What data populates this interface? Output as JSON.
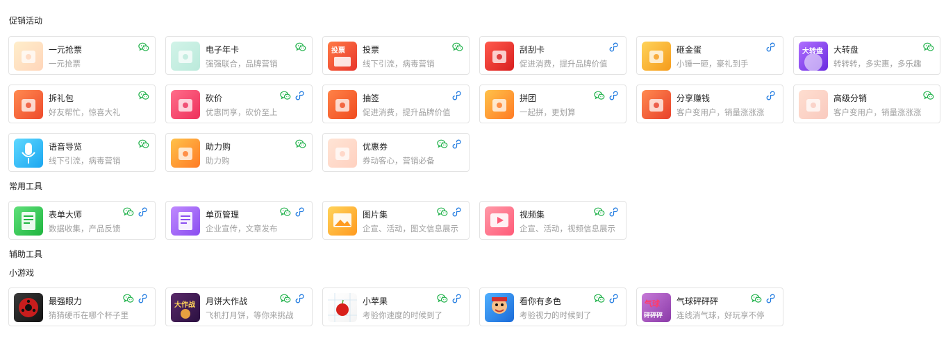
{
  "sections": {
    "promo": "促销活动",
    "tools": "常用工具",
    "aux": "辅助工具",
    "games": "小游戏"
  },
  "colors": {
    "wechat": "#22b24c",
    "miniprogram": "#1f7ae0"
  },
  "promo_items": [
    {
      "name": "一元抢票",
      "desc": "一元抢票",
      "icon": "ticket-icon",
      "wechat": true,
      "mini": false,
      "faded": true,
      "c1": "#ffcf6b",
      "c2": "#ff8a3d"
    },
    {
      "name": "电子年卡",
      "desc": "强强联合，品牌营销",
      "icon": "annual-card-icon",
      "wechat": true,
      "mini": false,
      "faded": true,
      "c1": "#7fe0c0",
      "c2": "#3fc39a"
    },
    {
      "name": "投票",
      "desc": "线下引流，病毒营销",
      "icon": "vote-icon",
      "wechat": true,
      "mini": false,
      "faded": false,
      "c1": "#ff7a45",
      "c2": "#e8362c"
    },
    {
      "name": "刮刮卡",
      "desc": "促进消费，提升品牌价值",
      "icon": "scratch-card-icon",
      "wechat": false,
      "mini": true,
      "faded": false,
      "c1": "#ff5a4d",
      "c2": "#d81e1e"
    },
    {
      "name": "砸金蛋",
      "desc": "小锤一砸，豪礼到手",
      "icon": "golden-egg-icon",
      "wechat": false,
      "mini": true,
      "faded": false,
      "c1": "#ffd35a",
      "c2": "#f59b1b"
    },
    {
      "name": "大转盘",
      "desc": "转转转，多实惠，多乐趣",
      "icon": "wheel-icon",
      "wechat": true,
      "mini": false,
      "faded": false,
      "c1": "#b070ff",
      "c2": "#6a2be0"
    },
    {
      "name": "拆礼包",
      "desc": "好友帮忙，惊喜大礼",
      "icon": "gift-icon",
      "wechat": true,
      "mini": false,
      "faded": false,
      "c1": "#ff8a50",
      "c2": "#ee4a2c"
    },
    {
      "name": "砍价",
      "desc": "优惠同享，砍价至上",
      "icon": "bargain-icon",
      "wechat": true,
      "mini": true,
      "faded": false,
      "c1": "#ff6d8a",
      "c2": "#ee2f5b"
    },
    {
      "name": "抽签",
      "desc": "促进消费，提升品牌价值",
      "icon": "lottery-icon",
      "wechat": false,
      "mini": true,
      "faded": false,
      "c1": "#ff8247",
      "c2": "#f04b1f"
    },
    {
      "name": "拼团",
      "desc": "一起拼，更划算",
      "icon": "group-buy-icon",
      "wechat": true,
      "mini": true,
      "faded": false,
      "c1": "#ffc24a",
      "c2": "#ff7b25"
    },
    {
      "name": "分享赚钱",
      "desc": "客户变用户，销量涨涨涨",
      "icon": "share-money-icon",
      "wechat": false,
      "mini": true,
      "faded": false,
      "c1": "#ff8a50",
      "c2": "#e8402a"
    },
    {
      "name": "高级分销",
      "desc": "客户变用户，销量涨涨涨",
      "icon": "distribution-icon",
      "wechat": true,
      "mini": false,
      "faded": true,
      "c1": "#ffa27a",
      "c2": "#f06a4a"
    },
    {
      "name": "语音导览",
      "desc": "线下引流，病毒营销",
      "icon": "voice-guide-icon",
      "wechat": true,
      "mini": false,
      "faded": false,
      "c1": "#5fd8ff",
      "c2": "#1aa6f0"
    },
    {
      "name": "助力购",
      "desc": "助力购",
      "icon": "assist-buy-icon",
      "wechat": true,
      "mini": false,
      "faded": false,
      "c1": "#ffc24a",
      "c2": "#ff7b25"
    },
    {
      "name": "优惠券",
      "desc": "券动客心，营销必备",
      "icon": "coupon-icon",
      "wechat": true,
      "mini": true,
      "faded": true,
      "c1": "#ffb48a",
      "c2": "#ff7d4d"
    }
  ],
  "tool_items": [
    {
      "name": "表单大师",
      "desc": "数据收集，产品反馈",
      "icon": "form-icon",
      "wechat": true,
      "mini": true,
      "faded": false,
      "c1": "#5fe07a",
      "c2": "#1fb53f"
    },
    {
      "name": "单页管理",
      "desc": "企业宣传，文章发布",
      "icon": "page-icon",
      "wechat": true,
      "mini": true,
      "faded": false,
      "c1": "#c08aff",
      "c2": "#8a4df0"
    },
    {
      "name": "图片集",
      "desc": "企宣、活动，图文信息展示",
      "icon": "gallery-icon",
      "wechat": true,
      "mini": true,
      "faded": false,
      "c1": "#ffd35a",
      "c2": "#ff9a1f"
    },
    {
      "name": "视频集",
      "desc": "企宣、活动，视频信息展示",
      "icon": "video-icon",
      "wechat": true,
      "mini": true,
      "faded": false,
      "c1": "#ff9aa8",
      "c2": "#ff5a78"
    }
  ],
  "game_items": [
    {
      "name": "最强眼力",
      "desc": "猜猜硬币在哪个杯子里",
      "icon": "eye-game-icon",
      "wechat": true,
      "mini": true,
      "faded": false,
      "c1": "#3a3a3a",
      "c2": "#111111"
    },
    {
      "name": "月饼大作战",
      "desc": "飞机打月饼，等你来挑战",
      "icon": "mooncake-game-icon",
      "wechat": true,
      "mini": true,
      "faded": false,
      "c1": "#5a2a6a",
      "c2": "#2a1040"
    },
    {
      "name": "小苹果",
      "desc": "考验你速度的时候到了",
      "icon": "apple-game-icon",
      "wechat": true,
      "mini": true,
      "faded": false,
      "c1": "#ffffff",
      "c2": "#f4f4f4"
    },
    {
      "name": "看你有多色",
      "desc": "考验视力的时候到了",
      "icon": "color-game-icon",
      "wechat": true,
      "mini": true,
      "faded": false,
      "c1": "#4fb0ff",
      "c2": "#1a6ad8"
    },
    {
      "name": "气球砰砰砰",
      "desc": "连线消气球，好玩享不停",
      "icon": "balloon-game-icon",
      "wechat": true,
      "mini": true,
      "faded": false,
      "c1": "#c77ad8",
      "c2": "#8a3aa8"
    }
  ]
}
